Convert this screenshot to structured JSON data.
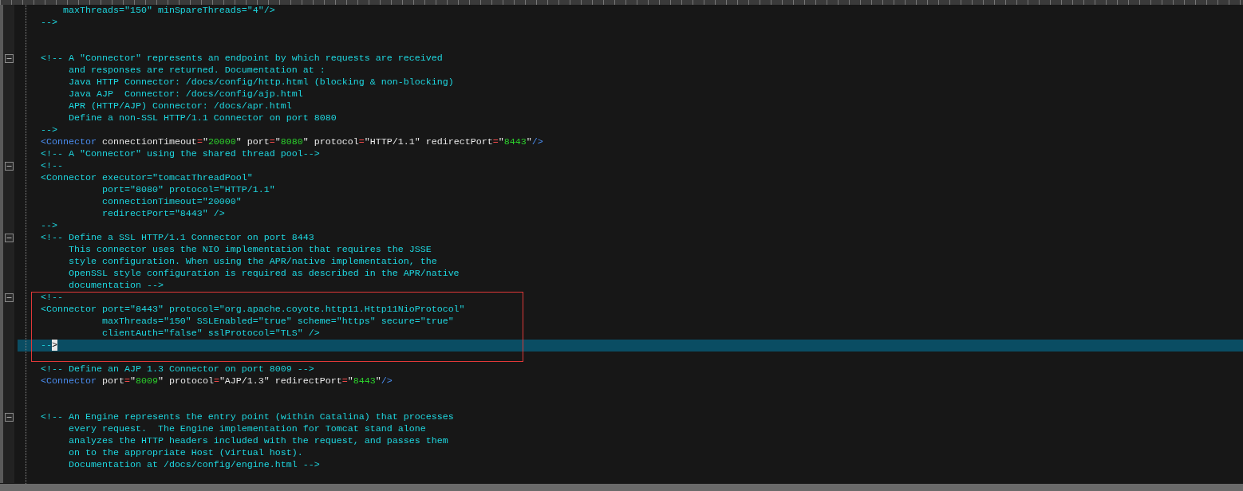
{
  "editor": {
    "lines": [
      {
        "fold": false,
        "current": false,
        "tokens": [
          {
            "kind": "comment",
            "text": "    maxThreads=\"150\" minSpareThreads=\"4\"/>"
          }
        ]
      },
      {
        "fold": false,
        "current": false,
        "tokens": [
          {
            "kind": "comment",
            "text": "-->"
          }
        ]
      },
      {
        "fold": false,
        "current": false
      },
      {
        "fold": false,
        "current": false
      },
      {
        "fold": true,
        "current": false,
        "tokens": [
          {
            "kind": "comment",
            "text": "<!-- A \"Connector\" represents an endpoint by which requests are received"
          }
        ]
      },
      {
        "fold": false,
        "current": false,
        "tokens": [
          {
            "kind": "comment",
            "text": "     and responses are returned. Documentation at :"
          }
        ]
      },
      {
        "fold": false,
        "current": false,
        "tokens": [
          {
            "kind": "comment",
            "text": "     Java HTTP Connector: /docs/config/http.html (blocking & non-blocking)"
          }
        ]
      },
      {
        "fold": false,
        "current": false,
        "tokens": [
          {
            "kind": "comment",
            "text": "     Java AJP  Connector: /docs/config/ajp.html"
          }
        ]
      },
      {
        "fold": false,
        "current": false,
        "tokens": [
          {
            "kind": "comment",
            "text": "     APR (HTTP/AJP) Connector: /docs/apr.html"
          }
        ]
      },
      {
        "fold": false,
        "current": false,
        "tokens": [
          {
            "kind": "comment",
            "text": "     Define a non-SSL HTTP/1.1 Connector on port 8080"
          }
        ]
      },
      {
        "fold": false,
        "current": false,
        "tokens": [
          {
            "kind": "comment",
            "text": "-->"
          }
        ]
      },
      {
        "fold": false,
        "current": false,
        "tokens": [
          {
            "kind": "tag",
            "text": "<Connector"
          },
          {
            "kind": "attr",
            "text": " connectionTimeout"
          },
          {
            "kind": "eq",
            "text": "="
          },
          {
            "kind": "attr",
            "text": "\""
          },
          {
            "kind": "value",
            "text": "20000"
          },
          {
            "kind": "attr",
            "text": "\" port"
          },
          {
            "kind": "eq",
            "text": "="
          },
          {
            "kind": "attr",
            "text": "\""
          },
          {
            "kind": "value",
            "text": "8080"
          },
          {
            "kind": "attr",
            "text": "\" protocol"
          },
          {
            "kind": "eq",
            "text": "="
          },
          {
            "kind": "attr",
            "text": "\"HTTP/1.1\" redirectPort"
          },
          {
            "kind": "eq",
            "text": "="
          },
          {
            "kind": "attr",
            "text": "\""
          },
          {
            "kind": "value",
            "text": "8443"
          },
          {
            "kind": "attr",
            "text": "\""
          },
          {
            "kind": "tag",
            "text": "/>"
          }
        ]
      },
      {
        "fold": false,
        "current": false,
        "tokens": [
          {
            "kind": "comment",
            "text": "<!-- A \"Connector\" using the shared thread pool-->"
          }
        ]
      },
      {
        "fold": true,
        "current": false,
        "tokens": [
          {
            "kind": "comment",
            "text": "<!--"
          }
        ]
      },
      {
        "fold": false,
        "current": false,
        "tokens": [
          {
            "kind": "comment",
            "text": "<Connector executor=\"tomcatThreadPool\""
          }
        ]
      },
      {
        "fold": false,
        "current": false,
        "tokens": [
          {
            "kind": "comment",
            "text": "           port=\"8080\" protocol=\"HTTP/1.1\""
          }
        ]
      },
      {
        "fold": false,
        "current": false,
        "tokens": [
          {
            "kind": "comment",
            "text": "           connectionTimeout=\"20000\""
          }
        ]
      },
      {
        "fold": false,
        "current": false,
        "tokens": [
          {
            "kind": "comment",
            "text": "           redirectPort=\"8443\" />"
          }
        ]
      },
      {
        "fold": false,
        "current": false,
        "tokens": [
          {
            "kind": "comment",
            "text": "-->"
          }
        ]
      },
      {
        "fold": true,
        "current": false,
        "tokens": [
          {
            "kind": "comment",
            "text": "<!-- Define a SSL HTTP/1.1 Connector on port 8443"
          }
        ]
      },
      {
        "fold": false,
        "current": false,
        "tokens": [
          {
            "kind": "comment",
            "text": "     This connector uses the NIO implementation that requires the JSSE"
          }
        ]
      },
      {
        "fold": false,
        "current": false,
        "tokens": [
          {
            "kind": "comment",
            "text": "     style configuration. When using the APR/native implementation, the"
          }
        ]
      },
      {
        "fold": false,
        "current": false,
        "tokens": [
          {
            "kind": "comment",
            "text": "     OpenSSL style configuration is required as described in the APR/native"
          }
        ]
      },
      {
        "fold": false,
        "current": false,
        "tokens": [
          {
            "kind": "comment",
            "text": "     documentation -->"
          }
        ]
      },
      {
        "fold": true,
        "current": false,
        "tokens": [
          {
            "kind": "comment",
            "text": "<!--"
          }
        ]
      },
      {
        "fold": false,
        "current": false,
        "tokens": [
          {
            "kind": "comment",
            "text": "<Connector port=\"8443\" protocol=\"org.apache.coyote.http11.Http11NioProtocol\""
          }
        ]
      },
      {
        "fold": false,
        "current": false,
        "tokens": [
          {
            "kind": "comment",
            "text": "           maxThreads=\"150\" SSLEnabled=\"true\" scheme=\"https\" secure=\"true\""
          }
        ]
      },
      {
        "fold": false,
        "current": false,
        "tokens": [
          {
            "kind": "comment",
            "text": "           clientAuth=\"false\" sslProtocol=\"TLS\" />"
          }
        ]
      },
      {
        "fold": false,
        "current": true,
        "tokens": [
          {
            "kind": "comment",
            "text": "--"
          },
          {
            "kind": "cursor",
            "text": ">"
          }
        ]
      },
      {
        "fold": false,
        "current": false
      },
      {
        "fold": false,
        "current": false,
        "tokens": [
          {
            "kind": "comment",
            "text": "<!-- Define an AJP 1.3 Connector on port 8009 -->"
          }
        ]
      },
      {
        "fold": false,
        "current": false,
        "tokens": [
          {
            "kind": "tag",
            "text": "<Connector"
          },
          {
            "kind": "attr",
            "text": " port"
          },
          {
            "kind": "eq",
            "text": "="
          },
          {
            "kind": "attr",
            "text": "\""
          },
          {
            "kind": "value",
            "text": "8009"
          },
          {
            "kind": "attr",
            "text": "\" protocol"
          },
          {
            "kind": "eq",
            "text": "="
          },
          {
            "kind": "attr",
            "text": "\"AJP/1.3\" redirectPort"
          },
          {
            "kind": "eq",
            "text": "="
          },
          {
            "kind": "attr",
            "text": "\""
          },
          {
            "kind": "value",
            "text": "8443"
          },
          {
            "kind": "attr",
            "text": "\""
          },
          {
            "kind": "tag",
            "text": "/>"
          }
        ]
      },
      {
        "fold": false,
        "current": false
      },
      {
        "fold": false,
        "current": false
      },
      {
        "fold": true,
        "current": false,
        "tokens": [
          {
            "kind": "comment",
            "text": "<!-- An Engine represents the entry point (within Catalina) that processes"
          }
        ]
      },
      {
        "fold": false,
        "current": false,
        "tokens": [
          {
            "kind": "comment",
            "text": "     every request.  The Engine implementation for Tomcat stand alone"
          }
        ]
      },
      {
        "fold": false,
        "current": false,
        "tokens": [
          {
            "kind": "comment",
            "text": "     analyzes the HTTP headers included with the request, and passes them"
          }
        ]
      },
      {
        "fold": false,
        "current": false,
        "tokens": [
          {
            "kind": "comment",
            "text": "     on to the appropriate Host (virtual host)."
          }
        ]
      },
      {
        "fold": false,
        "current": false,
        "tokens": [
          {
            "kind": "comment",
            "text": "     Documentation at /docs/config/engine.html -->"
          }
        ]
      },
      {
        "fold": false,
        "current": false
      }
    ]
  }
}
